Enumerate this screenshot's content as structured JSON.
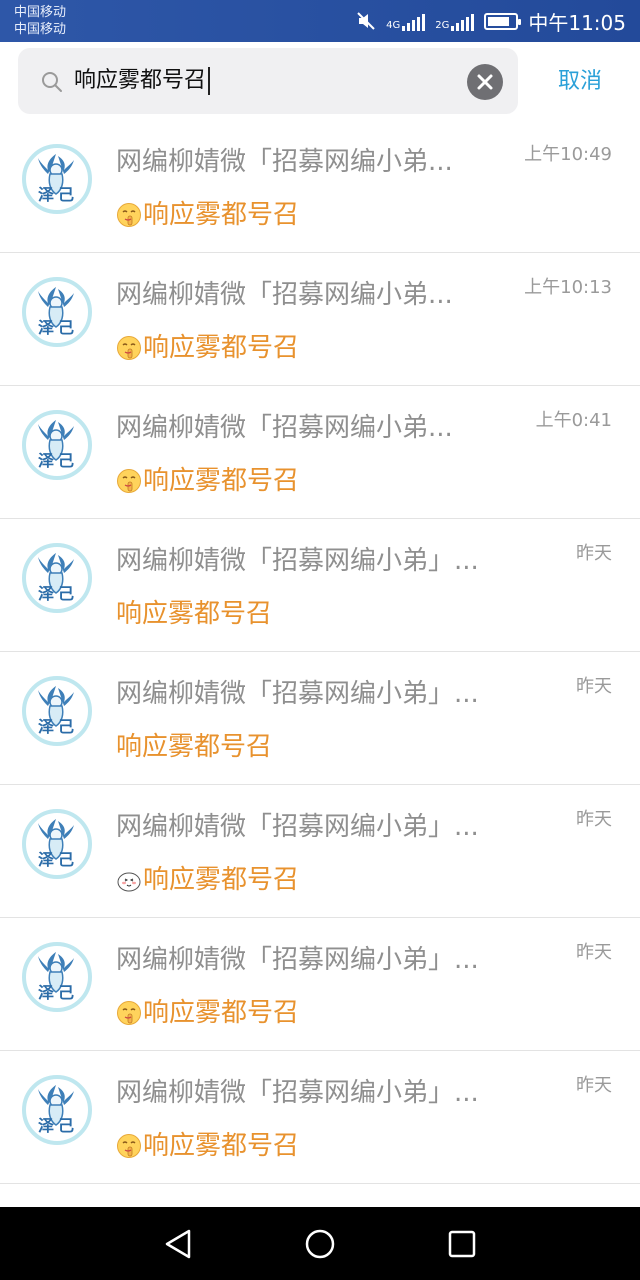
{
  "status_bar": {
    "carrier_1": "中国移动",
    "carrier_2": "中国移动",
    "network_1": "4G",
    "network_2": "2G",
    "time": "中午11:05",
    "battery_level": 0.8
  },
  "search": {
    "query": "响应雾都号召",
    "cancel_label": "取消"
  },
  "results": [
    {
      "title": "网编柳婧微「招募网编小弟...",
      "time": "上午10:49",
      "message": "响应雾都号召",
      "emoji": "shush-emoji"
    },
    {
      "title": "网编柳婧微「招募网编小弟...",
      "time": "上午10:13",
      "message": "响应雾都号召",
      "emoji": "shush-emoji"
    },
    {
      "title": "网编柳婧微「招募网编小弟...",
      "time": "上午0:41",
      "message": "响应雾都号召",
      "emoji": "shush-emoji"
    },
    {
      "title": "网编柳婧微「招募网编小弟」...",
      "time": "昨天",
      "message": "响应雾都号召",
      "emoji": ""
    },
    {
      "title": "网编柳婧微「招募网编小弟」...",
      "time": "昨天",
      "message": "响应雾都号召",
      "emoji": ""
    },
    {
      "title": "网编柳婧微「招募网编小弟」...",
      "time": "昨天",
      "message": "响应雾都号召",
      "emoji": "cute-face-emoji"
    },
    {
      "title": "网编柳婧微「招募网编小弟」...",
      "time": "昨天",
      "message": "响应雾都号召",
      "emoji": "shush-emoji"
    },
    {
      "title": "网编柳婧微「招募网编小弟」...",
      "time": "昨天",
      "message": "响应雾都号召",
      "emoji": "shush-emoji"
    }
  ],
  "colors": {
    "status_bar": "#2e57a8",
    "accent": "#2aa0d8",
    "highlight": "#e8922e",
    "title": "#8f8f8f"
  },
  "icons": {
    "search": "search-icon",
    "clear": "clear-icon",
    "back": "back-triangle-icon",
    "home": "home-circle-icon",
    "recents": "recents-square-icon"
  }
}
